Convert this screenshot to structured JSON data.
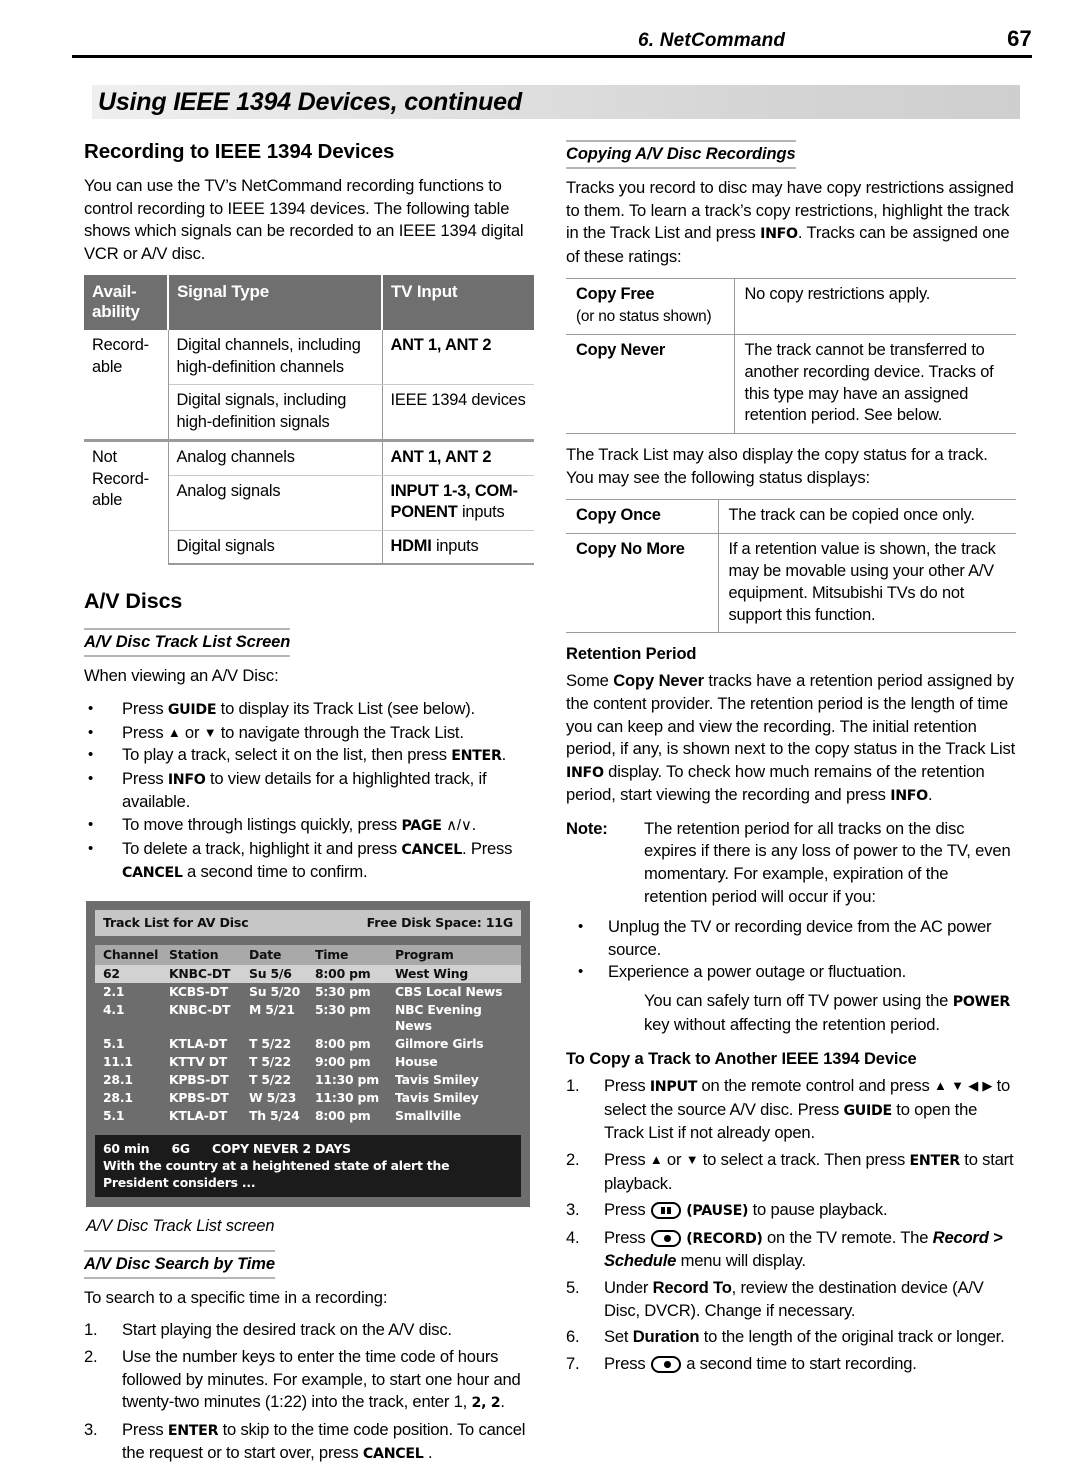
{
  "header": {
    "chapter": "6.  NetCommand",
    "page_number": "67"
  },
  "banner": {
    "title": "Using IEEE 1394 Devices, continued"
  },
  "left": {
    "heading_recording": "Recording to IEEE 1394 Devices",
    "intro": "You can use the TV’s NetCommand recording functions to control recording to IEEE 1394 devices.  The following table shows which signals can be recorded to an IEEE 1394 digital VCR or A/V disc.",
    "signal_table": {
      "headers": {
        "availability": "Avail-\nability",
        "signal_type": "Signal Type",
        "tv_input": "TV Input"
      },
      "rows": [
        {
          "availability": "Record-\nable",
          "signal_type": "Digital channels, including high-definition channels",
          "tv_input_bold": "ANT 1,  ANT 2",
          "tv_input_rest": ""
        },
        {
          "availability": "",
          "signal_type": "Digital signals, including high-definition signals",
          "tv_input_bold": "",
          "tv_input_rest": "IEEE 1394 devices"
        },
        {
          "availability": "Not Record-\nable",
          "signal_type": "Analog channels",
          "tv_input_bold": "ANT 1,  ANT 2",
          "tv_input_rest": ""
        },
        {
          "availability": "",
          "signal_type": "Analog signals",
          "tv_input_bold": "INPUT 1-3, COMPONENT",
          "tv_input_rest": " inputs"
        },
        {
          "availability": "",
          "signal_type": "Digital signals",
          "tv_input_bold": "HDMI",
          "tv_input_rest": " inputs"
        }
      ]
    },
    "heading_av_discs": "A/V Discs",
    "sub_tracklist": "A/V Disc Track List Screen",
    "tracklist_intro": "When viewing an A/V Disc:",
    "tracklist_bullets": [
      "Press GUIDE to display its Track List (see below).",
      "Press ▲ or ▼ to navigate through the Track List.",
      "To play a track, select it on the list, then press ENTER.",
      "Press INFO to view details for a highlighted track, if available.",
      "To move through listings quickly, press PAGE ∧/∨.",
      "To delete a track, highlight it and press CANCEL. Press CANCEL a second time to confirm."
    ],
    "tv_screen": {
      "title": "Track List for AV Disc",
      "free_disk": "Free Disk Space:  11G",
      "columns": [
        "Channel",
        "Station",
        "Date",
        "Time",
        "Program"
      ],
      "tracks": [
        {
          "channel": "62",
          "station": "KNBC-DT",
          "date": "Su 5/6",
          "time": "8:00 pm",
          "program": "West Wing",
          "selected": true
        },
        {
          "channel": "2.1",
          "station": "KCBS-DT",
          "date": "Su 5/20",
          "time": "5:30 pm",
          "program": "CBS Local News",
          "selected": false
        },
        {
          "channel": "4.1",
          "station": "KNBC-DT",
          "date": "M  5/21",
          "time": "5:30 pm",
          "program": "NBC Evening News",
          "selected": false
        },
        {
          "channel": "5.1",
          "station": "KTLA-DT",
          "date": "T  5/22",
          "time": "8:00 pm",
          "program": "Gilmore Girls",
          "selected": false
        },
        {
          "channel": "11.1",
          "station": "KTTV DT",
          "date": "T  5/22",
          "time": "9:00 pm",
          "program": "House",
          "selected": false
        },
        {
          "channel": "28.1",
          "station": "KPBS-DT",
          "date": "T  5/22",
          "time": "11:30 pm",
          "program": "Tavis Smiley",
          "selected": false
        },
        {
          "channel": "28.1",
          "station": "KPBS-DT",
          "date": "W  5/23",
          "time": "11:30 pm",
          "program": "Tavis Smiley",
          "selected": false
        },
        {
          "channel": "5.1",
          "station": "KTLA-DT",
          "date": "Th 5/24",
          "time": "8:00 pm",
          "program": "Smallville",
          "selected": false
        }
      ],
      "info_duration": "60 min",
      "info_size": "6G",
      "info_copy": "COPY NEVER 2 DAYS",
      "info_desc": "With the country at a heightened state of alert the President considers ..."
    },
    "caption": "A/V Disc Track List screen",
    "sub_search": "A/V Disc Search by Time",
    "search_intro": "To search to a specific time in a recording:",
    "search_steps": [
      "Start playing the desired track on the A/V disc.",
      "Use the number keys to enter the time code of hours followed by minutes.  For example, to start one hour and twenty-two minutes (1:22) into the track, enter 1, 2, 2.",
      "Press ENTER to skip to the time code position.  To cancel the request or to start over, press CANCEL ."
    ]
  },
  "right": {
    "sub_copying": "Copying A/V Disc Recordings",
    "copying_intro": "Tracks you record to disc may have copy restrictions assigned to them.  To learn a track’s copy restrictions, highlight the track in the Track List and press INFO.  Tracks can be assigned one of these ratings:",
    "ratings_table": [
      {
        "label": "Copy Free",
        "sublabel": "(or no status shown)",
        "description": "No copy restrictions apply."
      },
      {
        "label": "Copy Never",
        "sublabel": "",
        "description": "The track cannot be transferred to another recording device.  Tracks of this type may have an assigned retention period.  See below."
      }
    ],
    "status_intro": "The Track List may also display the copy status for a track.  You may see the following status displays:",
    "status_table": [
      {
        "label": "Copy Once",
        "description": "The track can be copied once only."
      },
      {
        "label": "Copy No More",
        "description": "If a retention value is shown, the track may be movable using your other A/V equipment.  Mitsubishi TVs do not support this function."
      }
    ],
    "heading_retention": "Retention Period",
    "retention_body_1": "Some ",
    "retention_body_bold": "Copy Never",
    "retention_body_2": " tracks have a retention period assigned by the content provider.  The retention period is the length of time you can keep and view the recording.  The initial retention period, if any, is shown next to the copy status in the Track List ",
    "retention_key_1": "INFO",
    "retention_body_3": " display.  To check how much remains of the retention period, start viewing the recording and press ",
    "retention_key_2": "INFO",
    "retention_body_4": ".",
    "note_label": "Note:",
    "note_text": "The retention period for all tracks on the disc expires if there is any loss of power to the TV, even momentary.  For example, expiration of the retention period will occur if you:",
    "note_bullets": [
      "Unplug the TV or recording device from the AC power source.",
      "Experience a power outage or fluctuation."
    ],
    "note_closing_1": "You can safely turn off TV power using the ",
    "note_closing_key": "POWER",
    "note_closing_2": " key without affecting the retention period.",
    "heading_copy_track": "To Copy a Track to Another IEEE 1394 Device",
    "copy_steps": [
      "Press INPUT on the remote control and press ▲ ▼ ◀ ▶ to select the source A/V disc.  Press GUIDE to open the Track List if not already open.",
      "Press ▲ or ▼ to select a track.  Then press ENTER to start playback.",
      "Press (PAUSE) to pause playback.",
      "Press (RECORD) on the TV remote.  The Record > Schedule menu will display.",
      "Under Record To, review the destination device (A/V Disc, DVCR).  Change if necessary.",
      "Set Duration to the length of the original track or longer.",
      "Press a second time to start recording."
    ],
    "step_labels": [
      "1.",
      "2.",
      "3.",
      "4.",
      "5.",
      "6.",
      "7."
    ],
    "icons": {
      "pause": "pause-key-icon",
      "record": "record-key-icon"
    }
  }
}
